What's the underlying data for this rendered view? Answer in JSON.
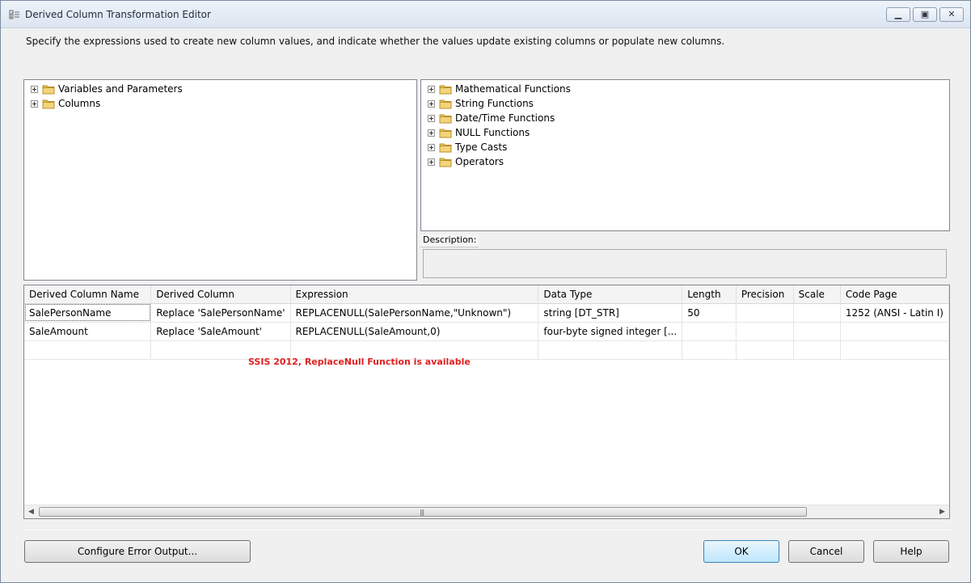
{
  "window": {
    "title": "Derived Column Transformation Editor",
    "instructions": "Specify the expressions used to create new column values, and indicate whether the values update existing columns or populate new columns."
  },
  "left_tree": {
    "items": [
      {
        "label": "Variables and Parameters"
      },
      {
        "label": "Columns"
      }
    ]
  },
  "right_tree": {
    "items": [
      {
        "label": "Mathematical Functions"
      },
      {
        "label": "String Functions"
      },
      {
        "label": "Date/Time Functions"
      },
      {
        "label": "NULL Functions"
      },
      {
        "label": "Type Casts"
      },
      {
        "label": "Operators"
      }
    ]
  },
  "description": {
    "label": "Description:"
  },
  "grid": {
    "columns": [
      "Derived Column Name",
      "Derived Column",
      "Expression",
      "Data Type",
      "Length",
      "Precision",
      "Scale",
      "Code Page"
    ],
    "rows": [
      [
        "SalePersonName",
        "Replace 'SalePersonName'",
        "REPLACENULL(SalePersonName,\"Unknown\")",
        "string [DT_STR]",
        "50",
        "",
        "",
        "1252  (ANSI - Latin I)"
      ],
      [
        "SaleAmount",
        "Replace 'SaleAmount'",
        "REPLACENULL(SaleAmount,0)",
        "four-byte signed integer [...",
        "",
        "",
        "",
        ""
      ],
      [
        "",
        "",
        "",
        "",
        "",
        "",
        "",
        ""
      ]
    ],
    "annotation": "SSIS 2012, ReplaceNull Function is available"
  },
  "buttons": {
    "configure_error_output": "Configure Error Output...",
    "ok": "OK",
    "cancel": "Cancel",
    "help": "Help"
  },
  "colors": {
    "annotation": "#e02020",
    "folder": "#e8c15a",
    "ok_border": "#3c7fb1"
  }
}
